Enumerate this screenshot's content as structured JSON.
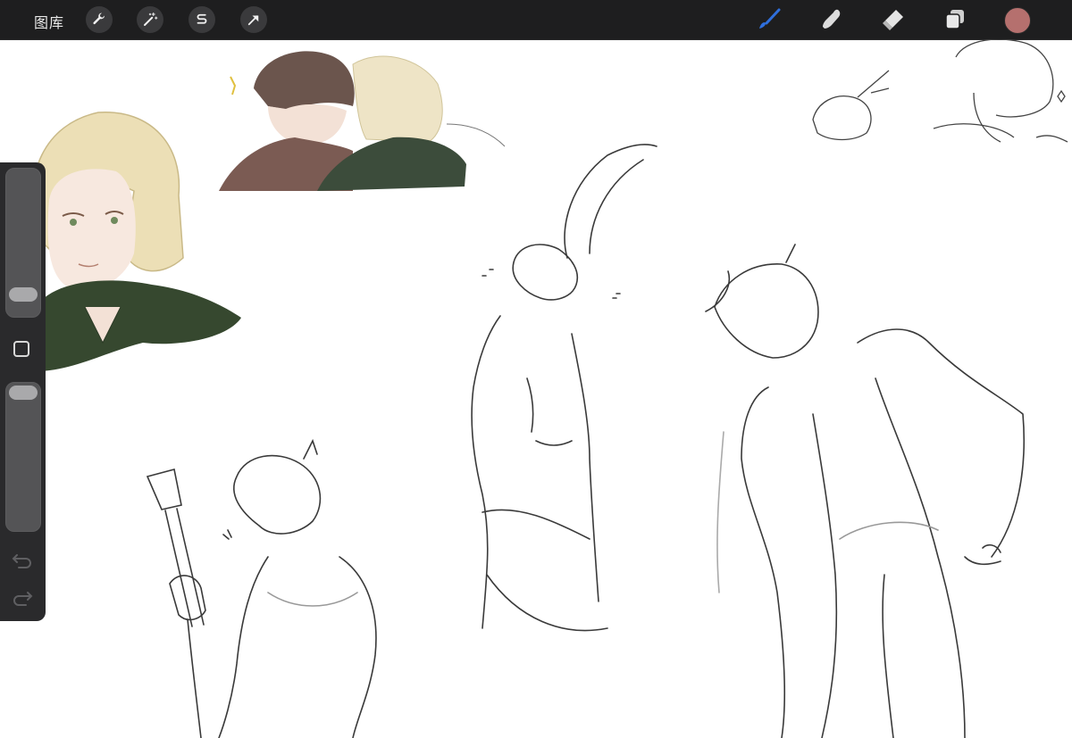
{
  "app": {
    "gallery_label": "图库",
    "left_tools": [
      {
        "name": "actions",
        "icon": "wrench-icon"
      },
      {
        "name": "adjustments",
        "icon": "magic-wand-icon"
      },
      {
        "name": "selection",
        "icon": "selection-s-icon"
      },
      {
        "name": "transform",
        "icon": "arrow-cursor-icon"
      }
    ],
    "right_tools": [
      {
        "name": "brush",
        "icon": "brush-icon",
        "active": true
      },
      {
        "name": "smudge",
        "icon": "smudge-finger-icon"
      },
      {
        "name": "eraser",
        "icon": "eraser-icon"
      },
      {
        "name": "layers",
        "icon": "layers-icon"
      }
    ],
    "current_color": "#b5706e",
    "accent": "#2f6fdc"
  },
  "sidebar": {
    "size_level": 0.1,
    "opacity_level": 1.0,
    "modify_icon": "square-outline-icon",
    "undo_icon": "undo-arrow-icon",
    "redo_icon": "redo-arrow-icon"
  },
  "palette": {
    "hair_blond": "#e9dcb0",
    "hair_brown": "#6f5a52",
    "hoodie_green": "#3b4d3a",
    "hoodie_brown": "#7a5a52",
    "skin": "#f3e1d6",
    "sketch": "#505050"
  }
}
